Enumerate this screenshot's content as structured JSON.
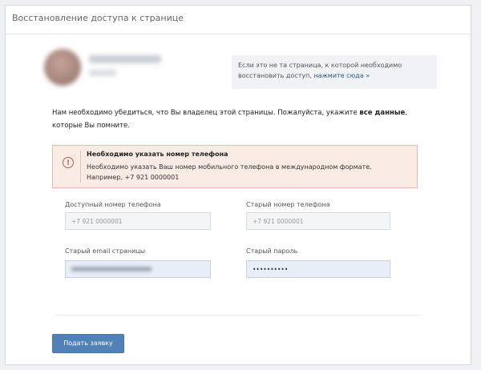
{
  "header": {
    "title": "Восстановление доступа к странице"
  },
  "notice": {
    "text": "Если это не та страница, к которой необходимо восстановить доступ,",
    "link": "нажмите сюда »"
  },
  "intro": {
    "text": "Нам необходимо убедиться, что Вы владелец этой страницы. Пожалуйста, укажите",
    "bold": "все данные",
    "tail": ", которые Вы помните."
  },
  "error": {
    "icon": "alert-icon",
    "title": "Необходимо указать номер телефона",
    "text": "Необходимо указать Ваш номер мобильного телефона в международном формате. Например, +7 921 0000001"
  },
  "form": {
    "phone_label": "Доступный номер телефона",
    "phone_placeholder": "+7 921 0000001",
    "old_phone_label": "Старый номер телефона",
    "old_phone_placeholder": "+7 921 0000001",
    "old_email_label": "Старый email страницы",
    "old_password_label": "Старый пароль",
    "old_password_value": "••••••••••"
  },
  "submit": {
    "label": "Подать заявку"
  }
}
